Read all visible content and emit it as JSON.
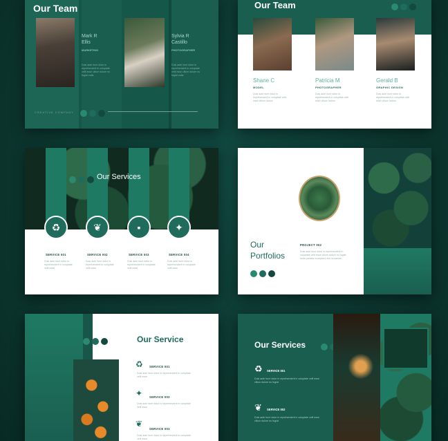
{
  "colors": {
    "background": "#0d3a33",
    "slide_green": "#1a5e50",
    "accent_green": "#2a8a70",
    "white": "#ffffff"
  },
  "slide1": {
    "title": "Our Team",
    "member1_name": "Mark R\nEllis",
    "member1_role": "MARKETING",
    "member2_name": "Sylvia R\nCastillo",
    "member2_role": "PHOTOGRAPHER",
    "footer": "CREATIVE COMPANY",
    "lorem": "Duis aute irure dolor in reprehenderit in voluptate velit esse cillum dolore eu fugiat nulla"
  },
  "slide2": {
    "title": "Our Team",
    "members": [
      {
        "name": "Shane C",
        "role": "MODEL"
      },
      {
        "name": "Patricia M",
        "role": "PHOTOGRAPHER"
      },
      {
        "name": "Gerald B",
        "role": "GRAPHIC DESIGN"
      }
    ],
    "lorem": "Duis aute irure dolor in reprehenderit in voluptate velit esse cillum dolore"
  },
  "slide3": {
    "title": "Our Services",
    "services": [
      {
        "label": "SERVICE 001",
        "icon": "recycle-icon"
      },
      {
        "label": "SERVICE 002",
        "icon": "plant-icon"
      },
      {
        "label": "SERVICE 003",
        "icon": "chat-icon"
      },
      {
        "label": "SERVICE 004",
        "icon": "bulb-icon"
      }
    ],
    "lorem": "Duis aute irure dolor in reprehenderit in voluptate velit esse"
  },
  "slide4": {
    "title": "Our\nPortfolios",
    "project_label": "PROJECT 002",
    "lorem": "Duis aute irure dolor in reprehenderit in voluptate velit esse cillum dolore eu fugiat nulla pariatur excepteur sint occaecat"
  },
  "slide5": {
    "title": "Our Service",
    "services": [
      {
        "label": "SERVICE 001",
        "icon": "recycle-icon"
      },
      {
        "label": "SERVICE 002",
        "icon": "bulb-icon"
      },
      {
        "label": "SERVICE 003",
        "icon": "plant-icon"
      }
    ],
    "lorem": "Duis aute irure dolor in reprehenderit in voluptate velit esse"
  },
  "slide6": {
    "title": "Our Services",
    "services": [
      {
        "label": "SERVICE 001",
        "icon": "recycle-icon"
      },
      {
        "label": "SERVICE 002",
        "icon": "plant-icon"
      }
    ],
    "lorem": "Duis aute irure dolor in reprehenderit in voluptate velit esse cillum dolore eu fugiat"
  }
}
